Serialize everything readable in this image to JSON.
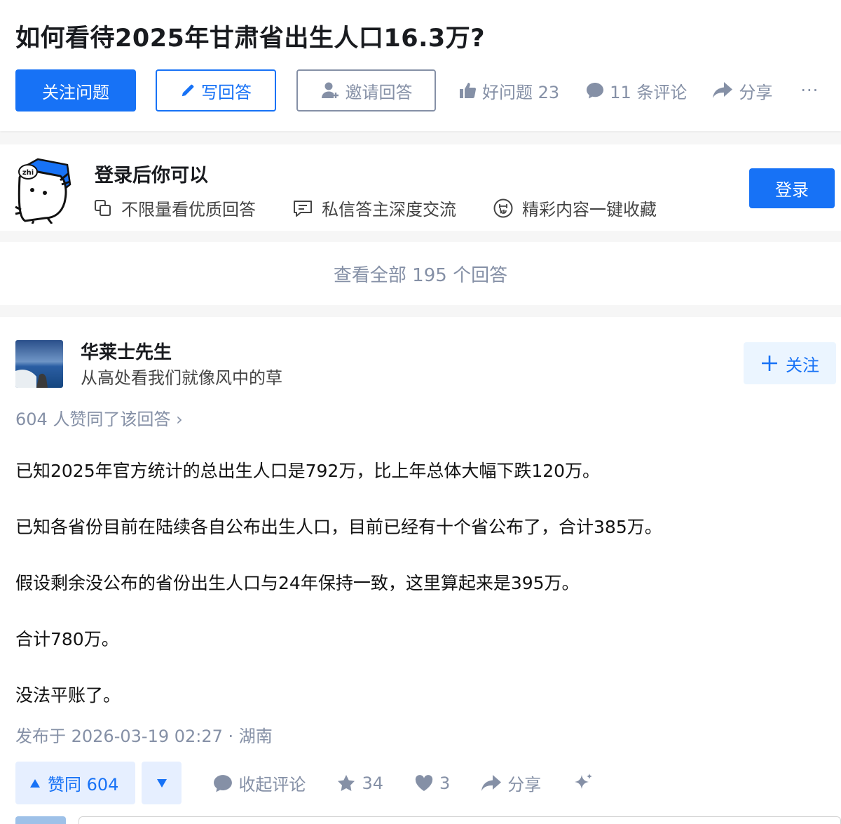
{
  "question": {
    "title": "如何看待2025年甘肃省出生人口16.3万?",
    "follow_label": "关注问题",
    "write_answer_label": "写回答",
    "invite_label": "邀请回答",
    "good_question_label": "好问题 23",
    "comments_label": "11 条评论",
    "share_label": "分享",
    "more_label": "···"
  },
  "login_promo": {
    "title": "登录后你可以",
    "benefits": [
      "不限量看优质回答",
      "私信答主深度交流",
      "精彩内容一键收藏"
    ],
    "login_label": "登录",
    "mascot_text": "zhi"
  },
  "view_all_label": "查看全部 195 个回答",
  "answer": {
    "author_name": "华莱士先生",
    "author_bio": "从高处看我们就像风中的草",
    "follow_label": "关注",
    "votes_line": "604 人赞同了该回答 ›",
    "paragraphs": [
      "已知2025年官方统计的总出生人口是792万，比上年总体大幅下跌120万。",
      "已知各省份目前在陆续各自公布出生人口，目前已经有十个省公布了，合计385万。",
      "假设剩余没公布的省份出生人口与24年保持一致，这里算起来是395万。",
      "合计780万。",
      "没法平账了。"
    ],
    "published": "发布于 2026-03-19 02:27 · 湖南",
    "upvote_label": "赞同 604",
    "collapse_comments_label": "收起评论",
    "favorites_count": "34",
    "likes_count": "3",
    "share_label": "分享"
  },
  "colors": {
    "brand_blue": "#1772f6",
    "gray_text": "#8590a6",
    "light_blue_bg": "#e6efff"
  },
  "icons": [
    "pencil-icon",
    "invite-user-icon",
    "thumb-up-icon",
    "comment-bubble-icon",
    "share-arrow-icon",
    "copy-icon",
    "message-icon",
    "favorite-icon",
    "plus-icon",
    "triangle-up-icon",
    "triangle-down-icon",
    "star-icon",
    "heart-icon",
    "sparkle-icon"
  ]
}
